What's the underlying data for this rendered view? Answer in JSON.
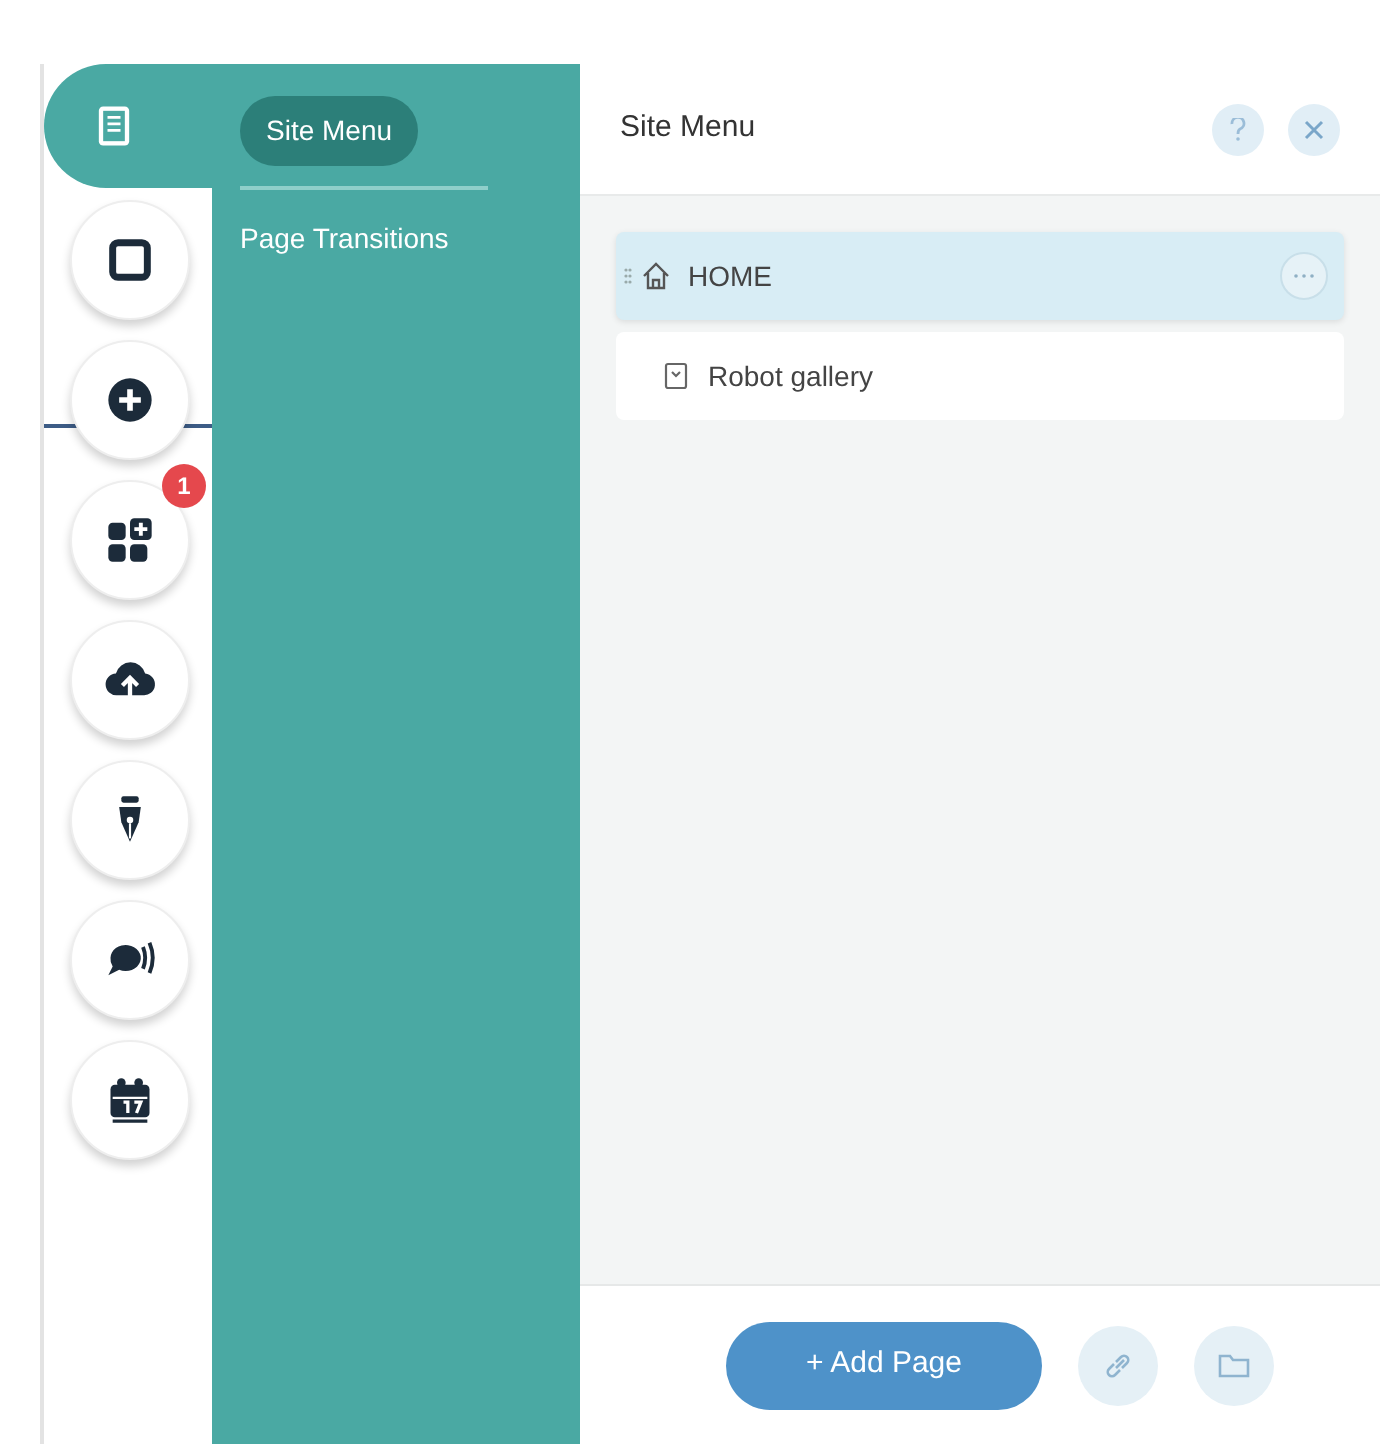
{
  "rail": [
    {
      "kind": "pages",
      "selected": true
    },
    {
      "kind": "background",
      "selected": false
    },
    {
      "kind": "add",
      "selected": false
    },
    {
      "kind": "apps",
      "selected": false,
      "badge": "1"
    },
    {
      "kind": "upload",
      "selected": false
    },
    {
      "kind": "pen",
      "selected": false
    },
    {
      "kind": "chat",
      "selected": false
    },
    {
      "kind": "calendar",
      "selected": false
    }
  ],
  "submenu": [
    {
      "label": "Site Menu",
      "selected": true
    },
    {
      "label": "Page Transitions",
      "selected": false
    }
  ],
  "panel": {
    "title": "Site Menu",
    "pages": [
      {
        "kind": "home",
        "label": "HOME",
        "selected": true
      },
      {
        "kind": "page",
        "label": "Robot gallery",
        "selected": false
      }
    ],
    "add_button": "+ Add Page"
  }
}
